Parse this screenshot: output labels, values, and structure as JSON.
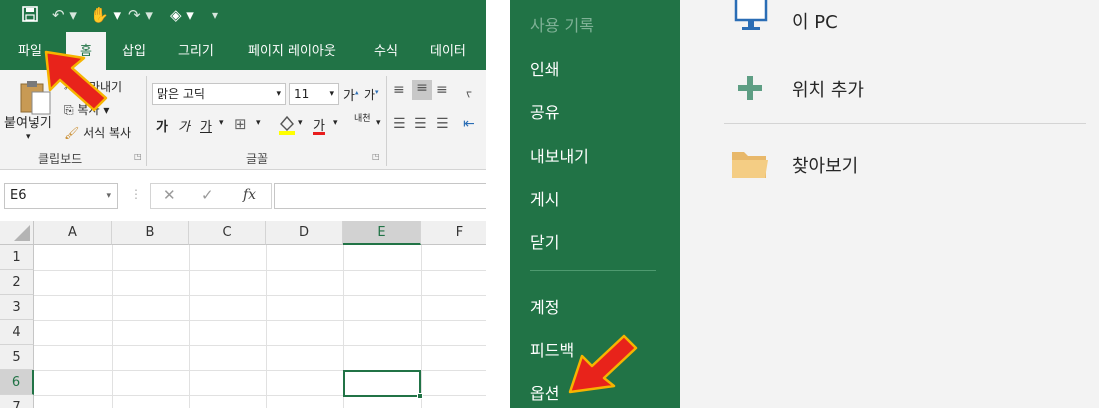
{
  "excel": {
    "tabs": [
      "파일",
      "홈",
      "삽입",
      "그리기",
      "페이지 레이아웃",
      "수식",
      "데이터"
    ],
    "clipboard": {
      "paste": "붙여넣기",
      "cut": "잘라내기",
      "copy": "복사",
      "format_painter": "서식 복사",
      "group": "클립보드"
    },
    "font": {
      "name": "맑은 고딕",
      "size": "11",
      "grow": "가",
      "shrink": "가",
      "bold": "가",
      "italic": "가",
      "underline": "가",
      "font_color": "가",
      "phonetic": "내천",
      "group": "글꼴"
    },
    "name_box": "E6",
    "formula_buttons": [
      "✕",
      "✓",
      "fx"
    ],
    "columns": [
      "A",
      "B",
      "C",
      "D",
      "E",
      "F"
    ],
    "rows": [
      "1",
      "2",
      "3",
      "4",
      "5",
      "6",
      "7"
    ],
    "selected_column": "E",
    "selected_row": "6"
  },
  "backstage": {
    "menu_top_faded": "사용 기록",
    "menu": [
      "인쇄",
      "공유",
      "내보내기",
      "게시",
      "닫기"
    ],
    "menu_bottom": [
      "계정",
      "피드백",
      "옵션"
    ],
    "locations": [
      {
        "label": "이 PC",
        "icon": "monitor-icon"
      },
      {
        "label": "위치 추가",
        "icon": "plus-icon"
      },
      {
        "label": "찾아보기",
        "icon": "folder-icon"
      }
    ]
  },
  "colors": {
    "excel_green": "#217346",
    "arrow_red": "#e8231b",
    "arrow_outline": "#f6b400"
  }
}
